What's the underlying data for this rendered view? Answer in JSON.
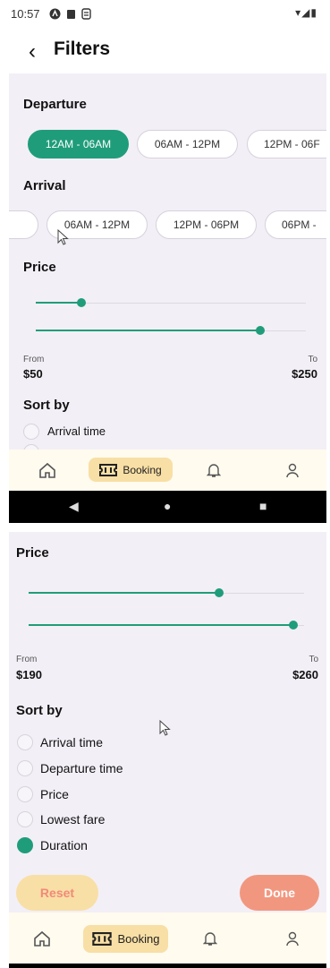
{
  "status_bar": {
    "time": "10:57",
    "icons": [
      "a-icon",
      "clipboard-icon",
      "s-icon"
    ],
    "right": "▾◢▮"
  },
  "header": {
    "back": "‹",
    "title": "Filters"
  },
  "top": {
    "departure": {
      "label": "Departure",
      "chips": [
        "12AM - 06AM",
        "06AM - 12PM",
        "12PM - 06F"
      ],
      "active_index": 0
    },
    "arrival": {
      "label": "Arrival",
      "chips": [
        "",
        "06AM - 12PM",
        "12PM - 06PM",
        "06PM -"
      ]
    },
    "price": {
      "label": "Price",
      "slider_min_fraction": 0.17,
      "slider_max_fraction": 0.83,
      "from_label": "From",
      "from_value": "$50",
      "to_label": "To",
      "to_value": "$250"
    },
    "sort": {
      "label": "Sort by",
      "options": [
        "Arrival time"
      ]
    }
  },
  "nav": {
    "booking_label": "Booking"
  },
  "bottom": {
    "price": {
      "label": "Price",
      "slider_min_fraction": 0.69,
      "slider_max_fraction": 0.96,
      "from_label": "From",
      "from_value": "$190",
      "to_label": "To",
      "to_value": "$260"
    },
    "sort": {
      "label": "Sort by",
      "options": [
        "Arrival time",
        "Departure time",
        "Price",
        "Lowest fare",
        "Duration"
      ],
      "selected_index": 4
    },
    "reset_label": "Reset",
    "done_label": "Done"
  }
}
